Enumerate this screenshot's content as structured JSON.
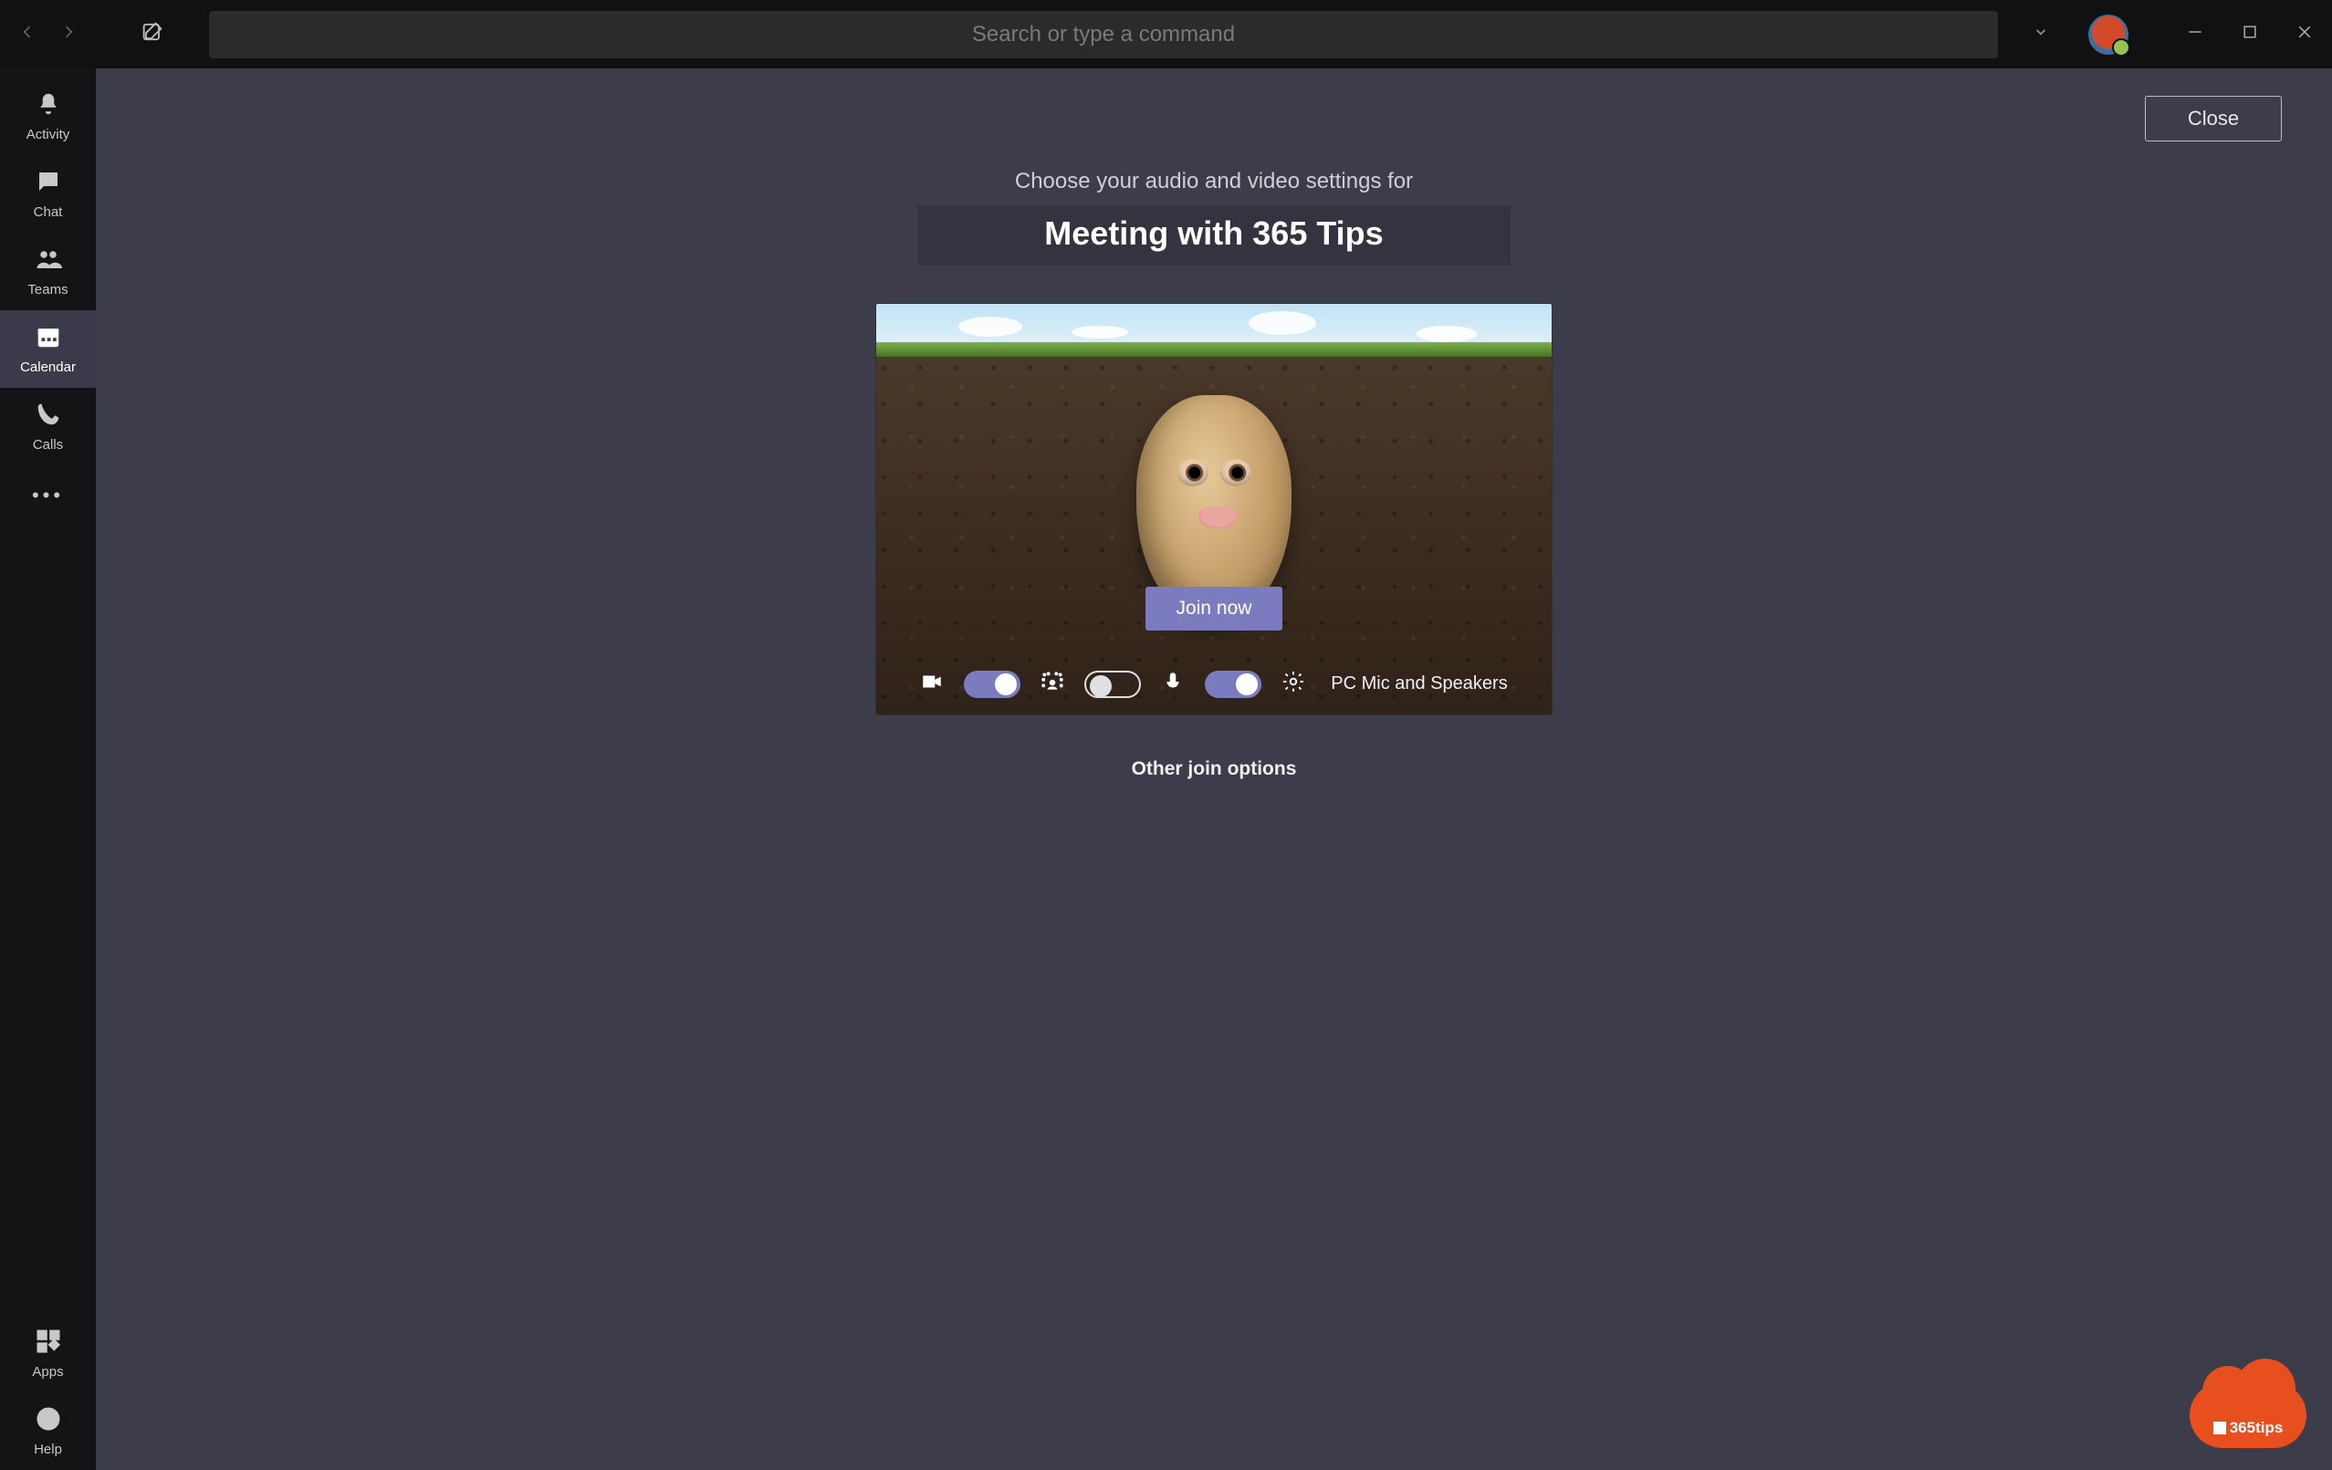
{
  "titlebar": {
    "search_placeholder": "Search or type a command"
  },
  "rail": {
    "items": [
      {
        "key": "activity",
        "label": "Activity"
      },
      {
        "key": "chat",
        "label": "Chat"
      },
      {
        "key": "teams",
        "label": "Teams"
      },
      {
        "key": "calendar",
        "label": "Calendar"
      },
      {
        "key": "calls",
        "label": "Calls"
      }
    ],
    "apps_label": "Apps",
    "help_label": "Help"
  },
  "prejoin": {
    "close_label": "Close",
    "subtitle": "Choose your audio and video settings for",
    "title": "Meeting with 365 Tips",
    "join_label": "Join now",
    "device_label": "PC Mic and Speakers",
    "other_options_label": "Other join options",
    "toggles": {
      "camera": "on",
      "blur": "off",
      "mic": "on"
    }
  },
  "watermark": {
    "text": "365tips"
  }
}
